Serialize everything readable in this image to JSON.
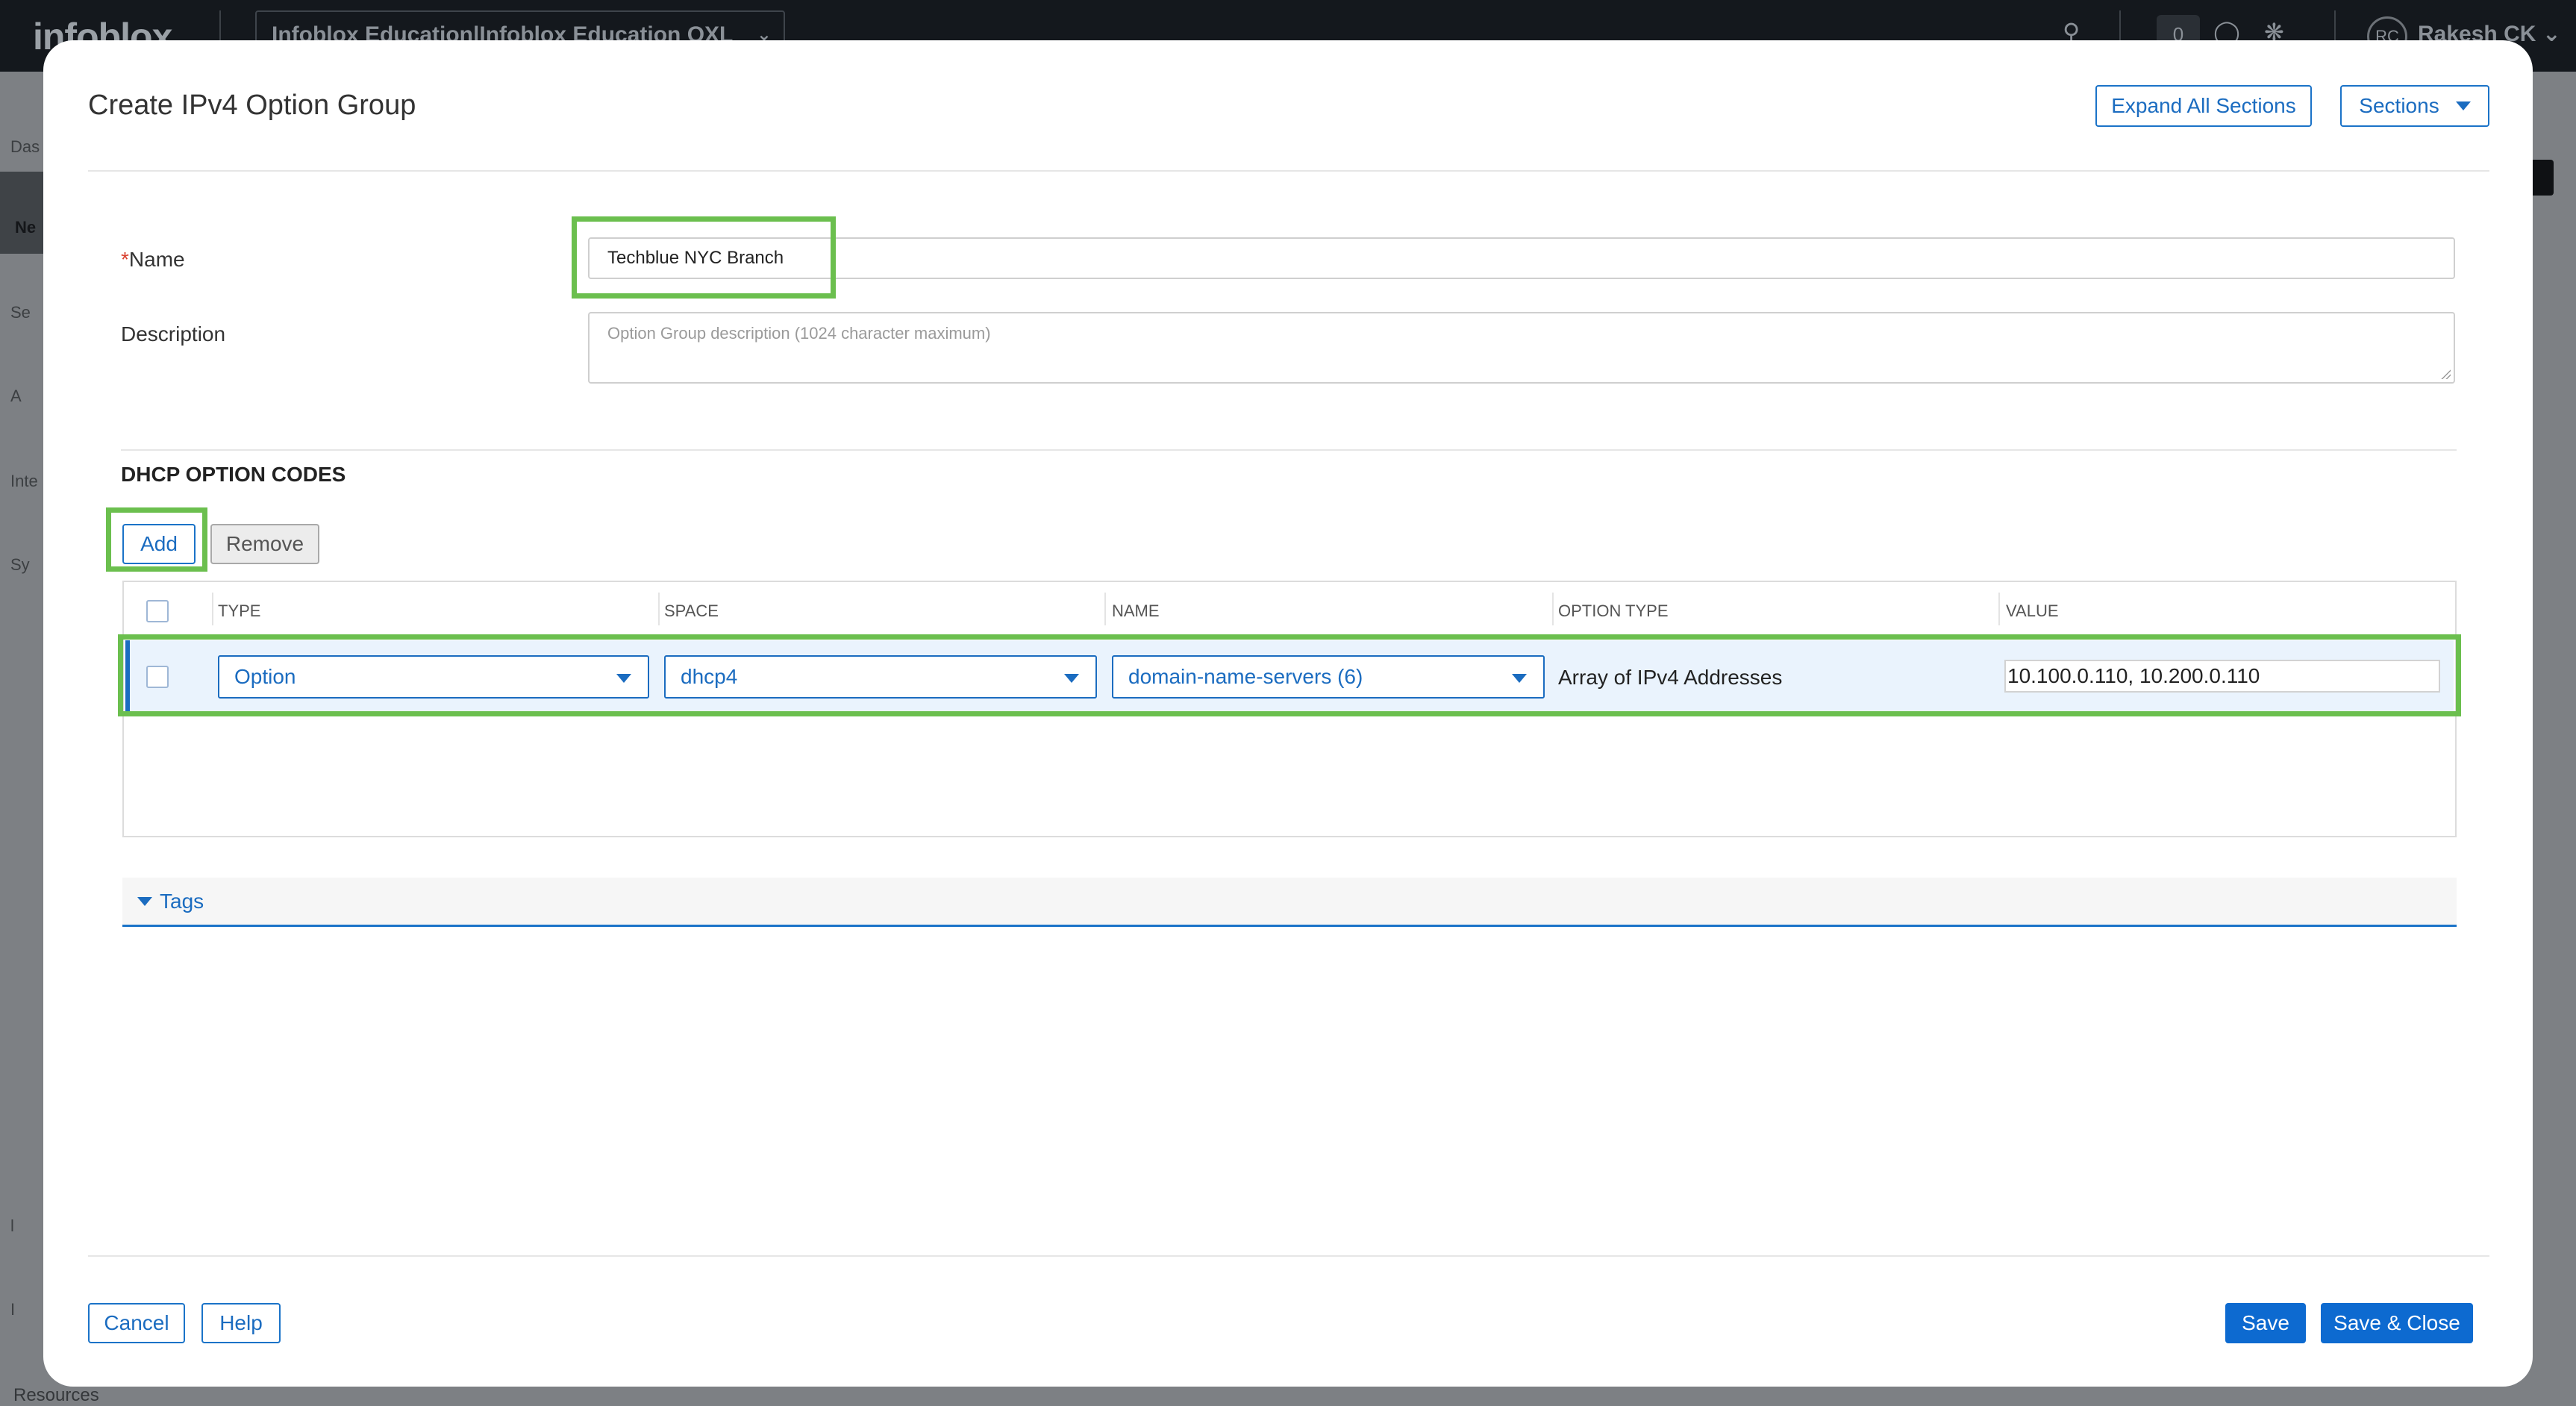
{
  "background": {
    "brand": "infoblox",
    "org_switcher": "Infoblox Education|Infoblox Education OXL",
    "notifications_count": "0",
    "user_initials": "RC",
    "user_name": "Rakesh CK",
    "sidebar_fragments": [
      "Das",
      "Ne",
      "Se",
      "A",
      "Inte",
      "Sy",
      "l",
      "I"
    ],
    "sidebar_resources": "Resources"
  },
  "modal": {
    "title": "Create IPv4 Option Group",
    "expand_all_label": "Expand All Sections",
    "sections_label": "Sections",
    "name_label": "Name",
    "name_required_mark": "*",
    "name_value": "Techblue NYC Branch",
    "description_label": "Description",
    "description_placeholder": "Option Group description (1024 character maximum)",
    "dhcp_section_title": "DHCP OPTION CODES",
    "add_label": "Add",
    "remove_label": "Remove",
    "table": {
      "columns": [
        "TYPE",
        "SPACE",
        "NAME",
        "OPTION TYPE",
        "VALUE"
      ],
      "rows": [
        {
          "type": "Option",
          "space": "dhcp4",
          "name": "domain-name-servers (6)",
          "option_type": "Array of IPv4 Addresses",
          "value": "10.100.0.110, 10.200.0.110"
        }
      ]
    },
    "tags_label": "Tags",
    "cancel_label": "Cancel",
    "help_label": "Help",
    "save_label": "Save",
    "save_close_label": "Save & Close"
  },
  "colors": {
    "accent": "#1b6cc0",
    "primary_button": "#0d6ad0",
    "highlight": "#6bbf4e",
    "required": "#d9402f"
  }
}
